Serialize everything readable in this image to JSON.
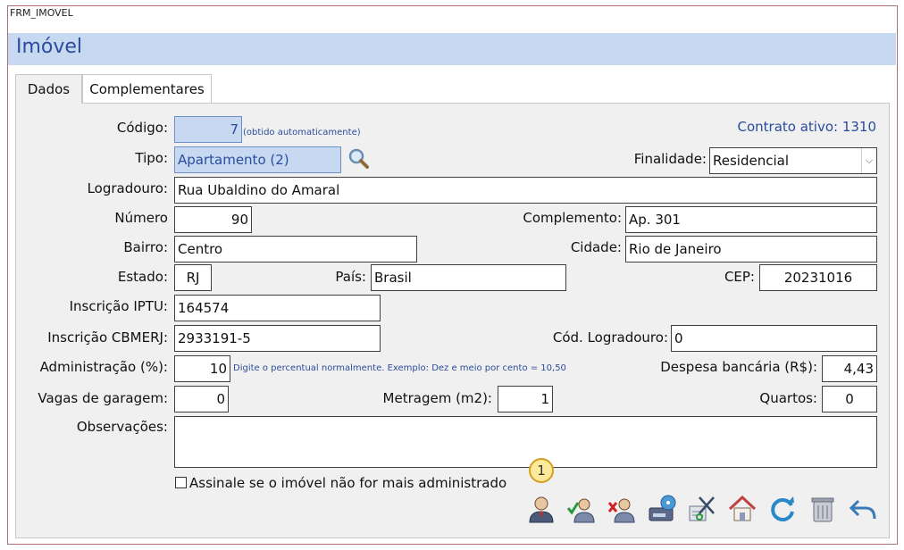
{
  "window": {
    "title": "FRM_IMOVEL",
    "header": "Imóvel"
  },
  "tabs": [
    "Dados",
    "Complementares"
  ],
  "contract": "Contrato ativo: 1310",
  "fields": {
    "codigo": {
      "label": "Código:",
      "value": "7",
      "hint": "(obtido automaticamente)"
    },
    "tipo": {
      "label": "Tipo:",
      "value": "Apartamento (2)"
    },
    "finalidade": {
      "label": "Finalidade:",
      "value": "Residencial"
    },
    "logradouro": {
      "label": "Logradouro:",
      "value": "Rua Ubaldino do Amaral"
    },
    "numero": {
      "label": "Número",
      "value": "90"
    },
    "complemento": {
      "label": "Complemento:",
      "value": "Ap. 301"
    },
    "bairro": {
      "label": "Bairro:",
      "value": "Centro"
    },
    "cidade": {
      "label": "Cidade:",
      "value": "Rio de Janeiro"
    },
    "estado": {
      "label": "Estado:",
      "value": "RJ"
    },
    "pais": {
      "label": "País:",
      "value": "Brasil"
    },
    "cep": {
      "label": "CEP:",
      "value": "20231016"
    },
    "iptu": {
      "label": "Inscrição IPTU:",
      "value": "164574"
    },
    "cbmerj": {
      "label": "Inscrição CBMERJ:",
      "value": "2933191-5"
    },
    "cod_logradouro": {
      "label": "Cód. Logradouro:",
      "value": "0"
    },
    "administracao": {
      "label": "Administração (%):",
      "value": "10",
      "hint": "Digite o percentual normalmente. Exemplo: Dez e meio por cento = 10,50"
    },
    "despesa": {
      "label": "Despesa bancária (R$):",
      "value": "4,43"
    },
    "vagas": {
      "label": "Vagas de garagem:",
      "value": "0"
    },
    "metragem": {
      "label": "Metragem (m2):",
      "value": "1"
    },
    "quartos": {
      "label": "Quartos:",
      "value": "0"
    },
    "observacoes": {
      "label": "Observações:",
      "value": ""
    }
  },
  "checkbox_label": "Assinale se o imóvel não for mais administrado",
  "badge": "1",
  "toolbar_icons": [
    "owner-icon",
    "approve-user-icon",
    "remove-user-icon",
    "save-disk-icon",
    "edit-scissors-icon",
    "home-icon",
    "refresh-icon",
    "trash-icon",
    "back-arrow-icon"
  ],
  "colors": {
    "header_bg": "#c6d9f1",
    "accent": "#2b4c9b",
    "border": "#b07078"
  }
}
